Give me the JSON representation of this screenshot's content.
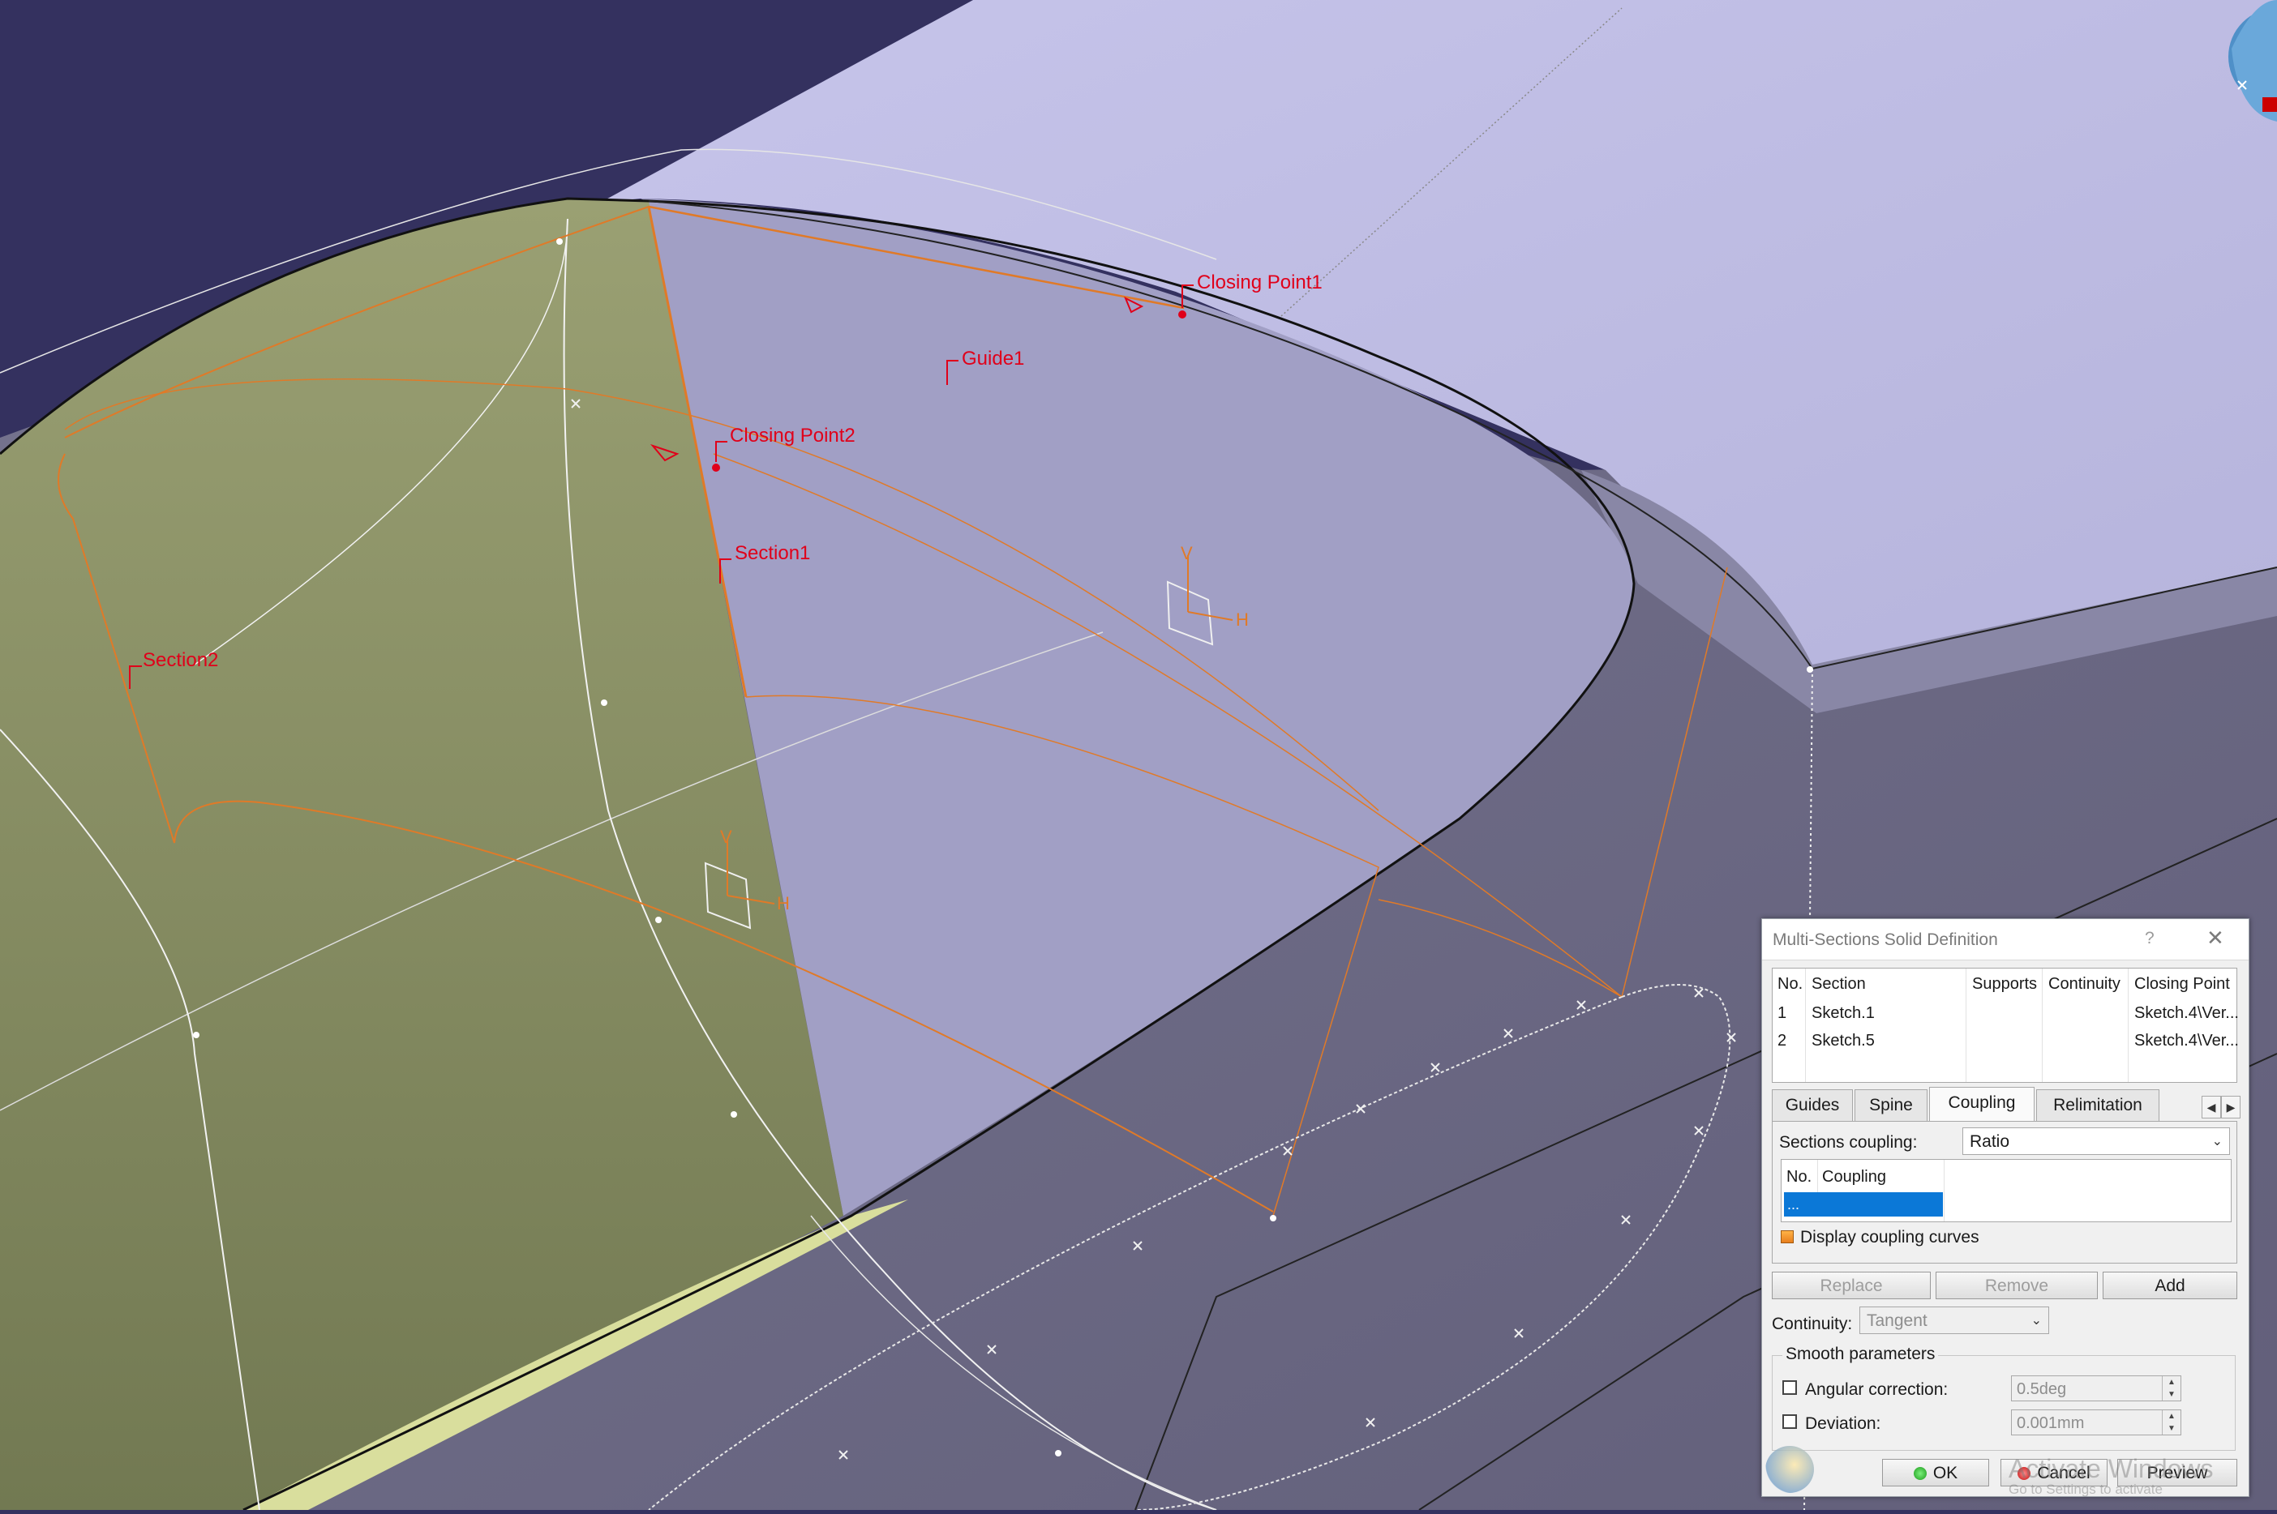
{
  "viewport": {
    "labels": {
      "closing_point1": "Closing Point1",
      "closing_point2": "Closing Point2",
      "guide1": "Guide1",
      "section1": "Section1",
      "section2": "Section2",
      "axis_v": "V",
      "axis_h": "H"
    },
    "colors": {
      "background": "#34315f",
      "surface_light": "#c2c0e6",
      "surface_mid": "#a09fc4",
      "surface_dark": "#6a6883",
      "section_green": "#848c5c",
      "curve_orange": "#e07a28",
      "label_red": "#e0001a"
    },
    "compass_icon": "compass-icon"
  },
  "dialog": {
    "title": "Multi-Sections Solid Definition",
    "help": "?",
    "close": "✕",
    "table": {
      "headers": [
        "No.",
        "Section",
        "Supports",
        "Continuity",
        "Closing Point"
      ],
      "rows": [
        {
          "no": "1",
          "section": "Sketch.1",
          "supports": "",
          "continuity": "",
          "closing_point": "Sketch.4\\Ver..."
        },
        {
          "no": "2",
          "section": "Sketch.5",
          "supports": "",
          "continuity": "",
          "closing_point": "Sketch.4\\Ver..."
        }
      ]
    },
    "tabs": [
      "Guides",
      "Spine",
      "Coupling",
      "Relimitation"
    ],
    "active_tab": "Coupling",
    "sections_coupling_label": "Sections coupling:",
    "sections_coupling_value": "Ratio",
    "coupling_list": {
      "headers": [
        "No.",
        "Coupling"
      ],
      "selected_row": "..."
    },
    "display_coupling_label": "Display coupling curves",
    "buttons": {
      "replace": "Replace",
      "remove": "Remove",
      "add": "Add"
    },
    "continuity_label": "Continuity:",
    "continuity_value": "Tangent",
    "smooth_legend": "Smooth parameters",
    "angular_label": "Angular correction:",
    "angular_value": "0.5deg",
    "deviation_label": "Deviation:",
    "deviation_value": "0.001mm",
    "ok": "OK",
    "cancel": "Cancel",
    "preview": "Preview",
    "watermark": "Activate Windows",
    "watermark_sub": "Go to Settings to activate"
  }
}
